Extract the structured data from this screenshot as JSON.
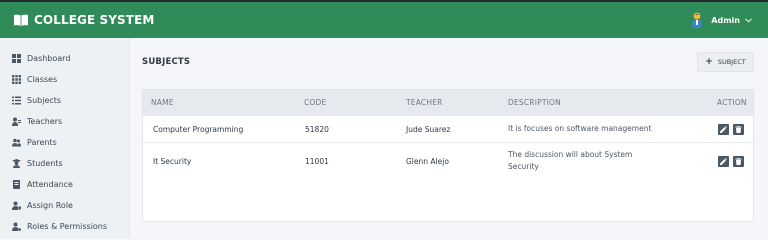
{
  "app": {
    "title": "COLLEGE SYSTEM"
  },
  "user": {
    "name": "Admin"
  },
  "sidebar": {
    "items": [
      {
        "label": "Dashboard",
        "icon": "dashboard-icon"
      },
      {
        "label": "Classes",
        "icon": "grid-icon"
      },
      {
        "label": "Subjects",
        "icon": "list-icon"
      },
      {
        "label": "Teachers",
        "icon": "teacher-icon"
      },
      {
        "label": "Parents",
        "icon": "users-icon"
      },
      {
        "label": "Students",
        "icon": "student-icon"
      },
      {
        "label": "Attendance",
        "icon": "book-icon"
      },
      {
        "label": "Assign Role",
        "icon": "user-tag-icon"
      },
      {
        "label": "Roles & Permissions",
        "icon": "user-cog-icon"
      }
    ]
  },
  "page": {
    "title": "SUBJECTS",
    "add_label": "SUBJECT"
  },
  "table": {
    "columns": [
      "NAME",
      "CODE",
      "TEACHER",
      "DESCRIPTION",
      "ACTION"
    ],
    "rows": [
      {
        "name": "Computer Programming",
        "code": "51820",
        "teacher": "Jude Suarez",
        "description_line1": "It is focuses on software management",
        "description_line2": ""
      },
      {
        "name": "It Security",
        "code": "11001",
        "teacher": "Glenn Alejo",
        "description_line1": "The discussion will about System",
        "description_line2": "Security"
      }
    ]
  },
  "colors": {
    "topbar": "#2f8b57",
    "sidebar": "#eef1f4",
    "action": "#4a5866"
  }
}
